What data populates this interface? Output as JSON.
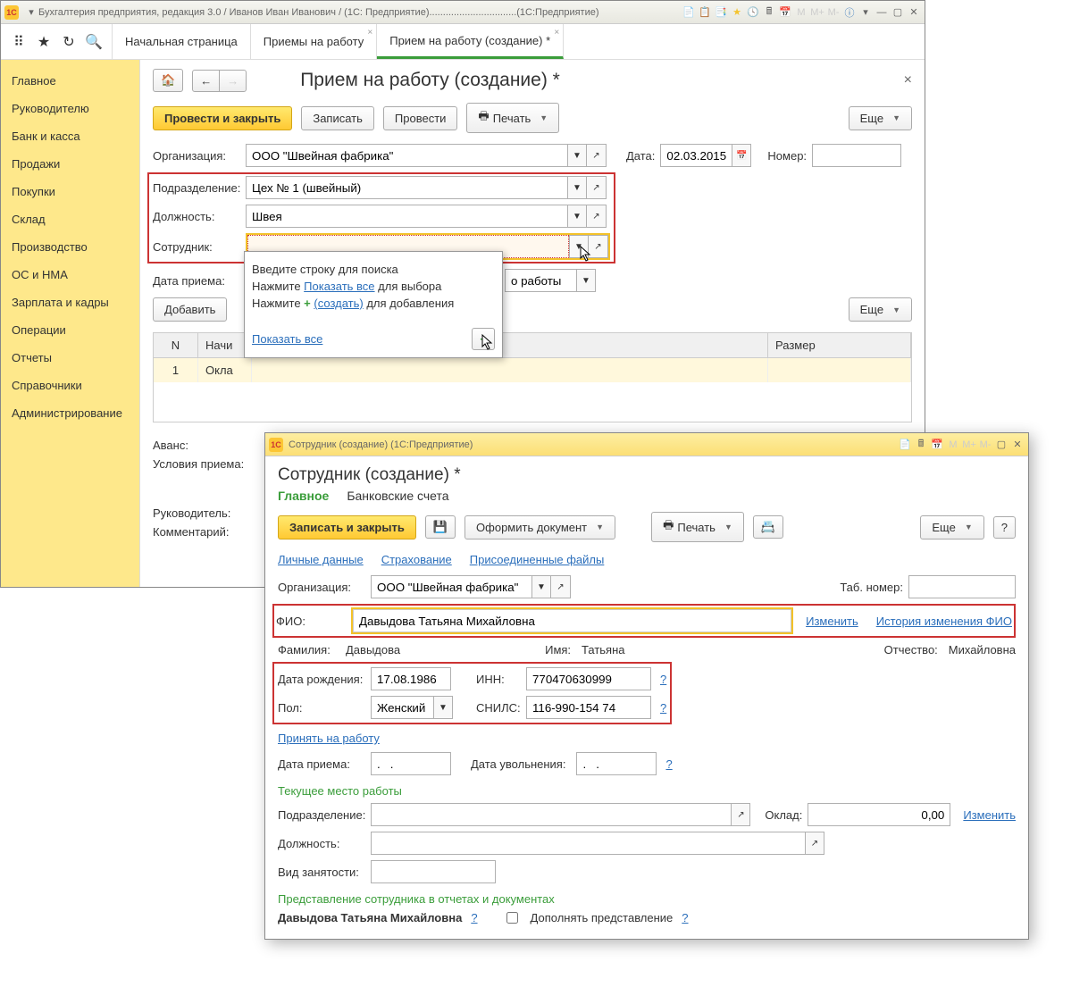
{
  "titlebar": {
    "text": "Бухгалтерия предприятия, редакция 3.0 / Иванов Иван Иванович / (1С: Предприятие)................................(1С:Предприятие)"
  },
  "tabs": {
    "t0": "Начальная страница",
    "t1": "Приемы на работу",
    "t2": "Прием на работу (создание) *"
  },
  "sidebar": [
    "Главное",
    "Руководителю",
    "Банк и касса",
    "Продажи",
    "Покупки",
    "Склад",
    "Производство",
    "ОС и НМА",
    "Зарплата и кадры",
    "Операции",
    "Отчеты",
    "Справочники",
    "Администрирование"
  ],
  "page": {
    "title": "Прием на работу (создание) *",
    "actions": {
      "save_close": "Провести и закрыть",
      "write": "Записать",
      "post": "Провести",
      "print": "Печать",
      "more": "Еще"
    },
    "labels": {
      "org": "Организация:",
      "dept": "Подразделение:",
      "pos": "Должность:",
      "emp": "Сотрудник:",
      "hire_date": "Дата приема:",
      "date": "Дата:",
      "number": "Номер:",
      "work_type_suffix": "о работы",
      "add": "Добавить",
      "advance": "Аванс:",
      "conditions": "Условия приема:",
      "manager": "Руководитель:",
      "comment": "Комментарий:"
    },
    "values": {
      "org": "ООО \"Швейная фабрика\"",
      "dept": "Цех № 1 (швейный)",
      "pos": "Швея",
      "date": "02.03.2015"
    },
    "popup": {
      "l1": "Введите строку для поиска",
      "l2a": "Нажмите ",
      "l2link": "Показать все",
      "l2b": " для выбора",
      "l3a": "Нажмите ",
      "l3link": "(создать)",
      "l3b": " для добавления",
      "showall": "Показать все"
    },
    "table": {
      "h1": "N",
      "h2": "Начи",
      "h3": "Размер",
      "r1c1": "1",
      "r1c2": "Окла"
    }
  },
  "modal": {
    "tb": "Сотрудник (создание)  (1С:Предприятие)",
    "title": "Сотрудник (создание) *",
    "tabs": {
      "main": "Главное",
      "bank": "Банковские счета"
    },
    "actions": {
      "save_close": "Записать и закрыть",
      "doc": "Оформить документ",
      "print": "Печать",
      "more": "Еще"
    },
    "links": {
      "personal": "Личные данные",
      "insurance": "Страхование",
      "files": "Присоединенные файлы",
      "change": "Изменить",
      "history": "История изменения ФИО",
      "hire": "Принять на работу"
    },
    "labels": {
      "org": "Организация:",
      "tabno": "Таб. номер:",
      "fio": "ФИО:",
      "lastname": "Фамилия:",
      "firstname": "Имя:",
      "patronymic": "Отчество:",
      "dob": "Дата рождения:",
      "inn": "ИНН:",
      "gender": "Пол:",
      "snils": "СНИЛС:",
      "hire_date": "Дата приема:",
      "fire_date": "Дата увольнения:",
      "dept": "Подразделение:",
      "salary": "Оклад:",
      "pos": "Должность:",
      "emp_type": "Вид занятости:",
      "add_repr": "Дополнять представление"
    },
    "headers": {
      "current": "Текущее место работы",
      "repr": "Представление сотрудника в отчетах и документах"
    },
    "values": {
      "org": "ООО \"Швейная фабрика\"",
      "fio": "Давыдова Татьяна Михайловна",
      "lastname": "Давыдова",
      "firstname": "Татьяна",
      "patronymic": "Михайловна",
      "dob": "17.08.1986",
      "inn": "770470630999",
      "gender": "Женский",
      "snils": "116-990-154 74",
      "date_ph": ".   .",
      "salary": "0,00",
      "repr_name": "Давыдова Татьяна Михайловна"
    }
  }
}
